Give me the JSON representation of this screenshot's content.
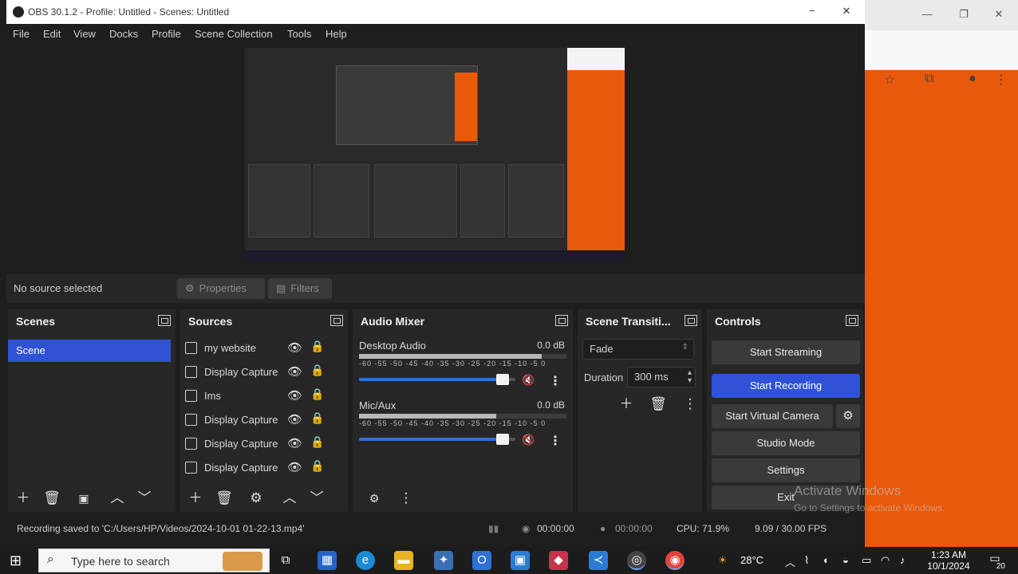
{
  "window": {
    "title": "OBS 30.1.2 - Profile: Untitled - Scenes: Untitled",
    "min": "−",
    "close": "✕"
  },
  "menu": [
    "File",
    "Edit",
    "View",
    "Docks",
    "Profile",
    "Scene Collection",
    "Tools",
    "Help"
  ],
  "context_bar": {
    "no_source": "No source selected",
    "properties": "Properties",
    "filters": "Filters"
  },
  "scenes": {
    "title": "Scenes",
    "items": [
      "Scene"
    ]
  },
  "sources": {
    "title": "Sources",
    "items": [
      "my website",
      "Display Capture",
      "Ims",
      "Display Capture",
      "Display Capture",
      "Display Capture"
    ]
  },
  "audio_mixer": {
    "title": "Audio Mixer",
    "channels": [
      {
        "name": "Desktop Audio",
        "db": "0.0 dB",
        "ticks": "-60 -55 -50 -45 -40 -35 -30 -25 -20 -15 -10 -5 0",
        "level": 0.88,
        "volume": 0.96
      },
      {
        "name": "Mic/Aux",
        "db": "0.0 dB",
        "ticks": "-60 -55 -50 -45 -40 -35 -30 -25 -20 -15 -10 -5 0",
        "level": 0.66,
        "volume": 0.96
      }
    ]
  },
  "transitions": {
    "title": "Scene Transiti...",
    "type": "Fade",
    "duration_label": "Duration",
    "duration_value": "300 ms"
  },
  "controls": {
    "title": "Controls",
    "start_streaming": "Start Streaming",
    "start_recording": "Start Recording",
    "start_virtual_camera": "Start Virtual Camera",
    "studio_mode": "Studio Mode",
    "settings": "Settings",
    "exit": "Exit"
  },
  "status": {
    "message": "Recording saved to 'C:/Users/HP/Videos/2024-10-01 01-22-13.mp4'",
    "stream_time": "00:00:00",
    "rec_time": "00:00:00",
    "cpu": "CPU: 71.9%",
    "fps": "9.09 / 30.00 FPS"
  },
  "watermark": {
    "title": "Activate Windows",
    "subtitle": "Go to Settings to activate Windows."
  },
  "taskbar": {
    "search_placeholder": "Type here to search",
    "weather": "28°C",
    "time": "1:23 AM",
    "date": "10/1/2024",
    "notifications": "20"
  },
  "colors": {
    "accent": "#2f52d6",
    "orange": "#e8590c",
    "panel": "#272727",
    "background": "#1e1e1e"
  }
}
